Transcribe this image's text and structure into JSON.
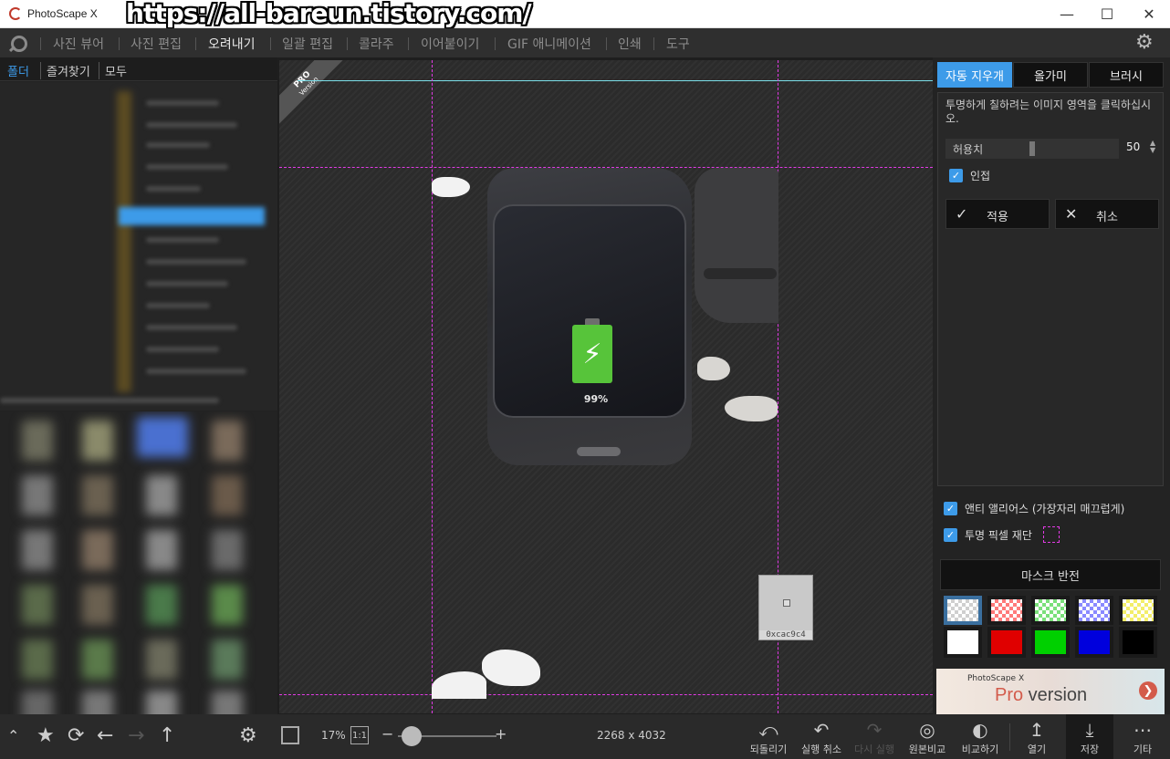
{
  "window": {
    "title": "PhotoScape X",
    "watermark": "https://all-bareun.tistory.com/",
    "minimize_icon": "minimize-icon",
    "maximize_icon": "maximize-icon",
    "close_icon": "close-icon"
  },
  "menu": {
    "items": [
      "사진 뷰어",
      "사진 편집",
      "오려내기",
      "일괄 편집",
      "콜라주",
      "이어붙이기",
      "GIF 애니메이션",
      "인쇄",
      "도구"
    ],
    "active_index": 2
  },
  "left_panel": {
    "tabs": [
      "폴더",
      "즐겨찾기",
      "모두"
    ],
    "active_tab": 0,
    "bottom_icons": [
      "chevron-up-icon",
      "star-icon",
      "refresh-icon",
      "arrow-left-icon",
      "arrow-right-icon",
      "arrow-up-icon",
      "gear-icon"
    ]
  },
  "canvas": {
    "pro_badge": "PRO",
    "pro_badge_sub": "Version",
    "battery_percent": "99%",
    "loupe_color": "0xcac9c4"
  },
  "right_panel": {
    "tabs": [
      "자동 지우개",
      "올가미",
      "브러시"
    ],
    "active_tab": 0,
    "instruction": "투명하게 칠하려는 이미지 영역을 클릭하십시오.",
    "tolerance_label": "허용치",
    "tolerance_value": "50",
    "adjacent_label": "인접",
    "apply_label": "적용",
    "cancel_label": "취소",
    "antialias_label": "앤티 앨리어스 (가장자리 매끄럽게)",
    "trim_label": "투명 픽셀 재단",
    "mask_invert_label": "마스크 반전",
    "promo_brand": "PhotoScape X",
    "promo_pro": "Pro",
    "promo_version": " version",
    "swatch_colors": [
      "#ffffff",
      "#ff0000",
      "#00ff00",
      "#0000ff",
      "#ffff00",
      "#ffffff",
      "#e00000",
      "#00d000",
      "#0000dd",
      "#000000"
    ]
  },
  "bottom_bar": {
    "zoom_value": "17%",
    "one_to_one": "1:1",
    "minus": "−",
    "plus": "+",
    "image_size": "2268 x 4032",
    "buttons": [
      {
        "label": "되돌리기",
        "icon": "revert-icon"
      },
      {
        "label": "실행 취소",
        "icon": "undo-icon"
      },
      {
        "label": "다시 실행",
        "icon": "redo-icon"
      },
      {
        "label": "원본비교",
        "icon": "compare-original-icon"
      },
      {
        "label": "비교하기",
        "icon": "compare-icon"
      },
      {
        "label": "열기",
        "icon": "open-icon"
      },
      {
        "label": "저장",
        "icon": "save-icon"
      },
      {
        "label": "기타",
        "icon": "more-icon"
      }
    ]
  }
}
